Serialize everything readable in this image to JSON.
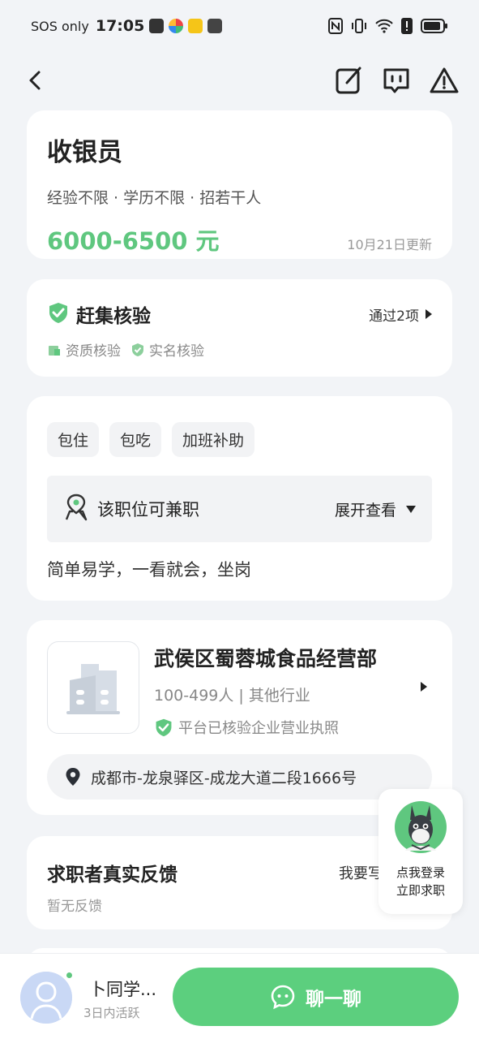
{
  "status_bar": {
    "carrier": "SOS only",
    "time": "17:05"
  },
  "job": {
    "title": "收银员",
    "meta": "经验不限 · 学历不限 · 招若干人",
    "salary": "6000-6500 元",
    "updated": "10月21日更新"
  },
  "verification": {
    "title": "赶集核验",
    "passed": "通过2项",
    "tags": [
      "资质核验",
      "实名核验"
    ]
  },
  "benefits": [
    "包住",
    "包吃",
    "加班补助"
  ],
  "parttime": {
    "label": "该职位可兼职",
    "expand": "展开查看"
  },
  "description": "简单易学，一看就会，坐岗",
  "company": {
    "name": "武侯区蜀蓉城食品经营部",
    "size_industry": "100-499人 | 其他行业",
    "license": "平台已核验企业营业执照",
    "address": "成都市-龙泉驿区-成龙大道二段1666号"
  },
  "feedback": {
    "title": "求职者真实反馈",
    "empty": "暂无反馈",
    "write": "我要写"
  },
  "float_login": {
    "line1": "点我登录",
    "line2": "立即求职"
  },
  "recruiter": {
    "name": "卜同学...",
    "active": "3日内活跃"
  },
  "chat_button": "聊一聊",
  "colors": {
    "accent": "#5fc77f",
    "button": "#5ccf7e",
    "background": "#f2f4f7"
  }
}
